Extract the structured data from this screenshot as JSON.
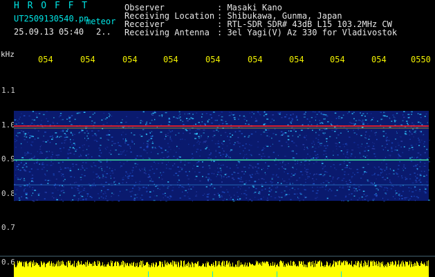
{
  "header": {
    "station_code": "H R O F F T",
    "file_name": "UT2509130540.pn",
    "file_suffix": "meteor",
    "date_time": "25.09.13 05:40",
    "page_marker": "2..",
    "fields": [
      {
        "label": "Observer",
        "value": ": Masaki Kano"
      },
      {
        "label": "Receiving Location",
        "value": ": Shibukawa, Gunma, Japan"
      },
      {
        "label": "Receiver",
        "value": ": RTL-SDR SDR# 43dB L15 103.2MHz CW"
      },
      {
        "label": "Receiving Antenna",
        "value": ": 3el Yagi(V) Az 330 for Vladivostok"
      }
    ]
  },
  "time_axis": {
    "labels": [
      "054",
      "054",
      "054",
      "054",
      "054",
      "054",
      "054",
      "054",
      "054",
      "0550"
    ]
  },
  "freq_axis": {
    "unit": "kHz",
    "labels": [
      "1.1",
      "1.0",
      "0.9",
      "0.8",
      "0.7",
      "0.6"
    ]
  },
  "colors": {
    "background": "#000000",
    "axis_text": "#00e5e5",
    "time_text": "#f0f000",
    "noise_low": "#0a1a6e",
    "noise_mid": "#1e50c8",
    "noise_high": "#30c8ff",
    "carrier": "#ff2020",
    "signal_bars": "#ffff00"
  }
}
